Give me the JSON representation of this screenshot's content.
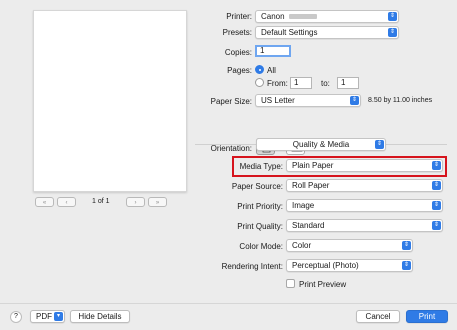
{
  "preview": {
    "page_counter": "1 of 1",
    "first_label": "«",
    "prev_label": "‹",
    "next_label": "›",
    "last_label": "»"
  },
  "printer": {
    "label": "Printer:",
    "value": "Canon"
  },
  "presets": {
    "label": "Presets:",
    "value": "Default Settings"
  },
  "copies": {
    "label": "Copies:",
    "value": "1"
  },
  "pages": {
    "label": "Pages:",
    "all_label": "All",
    "from_label": "From:",
    "from_value": "1",
    "to_label": "to:",
    "to_value": "1"
  },
  "paper_size": {
    "label": "Paper Size:",
    "value": "US Letter",
    "dimensions": "8.50 by 11.00 inches"
  },
  "orientation": {
    "label": "Orientation:"
  },
  "section_menu": {
    "value": "Quality & Media"
  },
  "media_type": {
    "label": "Media Type:",
    "value": "Plain Paper"
  },
  "paper_source": {
    "label": "Paper Source:",
    "value": "Roll Paper"
  },
  "print_priority": {
    "label": "Print Priority:",
    "value": "Image"
  },
  "print_quality": {
    "label": "Print Quality:",
    "value": "Standard"
  },
  "color_mode": {
    "label": "Color Mode:",
    "value": "Color"
  },
  "rendering_intent": {
    "label": "Rendering Intent:",
    "value": "Perceptual (Photo)"
  },
  "print_preview": {
    "label": "Print Preview",
    "checked": false
  },
  "footer": {
    "help_label": "?",
    "pdf_label": "PDF",
    "hide_details_label": "Hide Details",
    "cancel_label": "Cancel",
    "print_label": "Print"
  },
  "colors": {
    "accent": "#2f7be6",
    "highlight": "#d6141d",
    "background": "#ececec"
  }
}
